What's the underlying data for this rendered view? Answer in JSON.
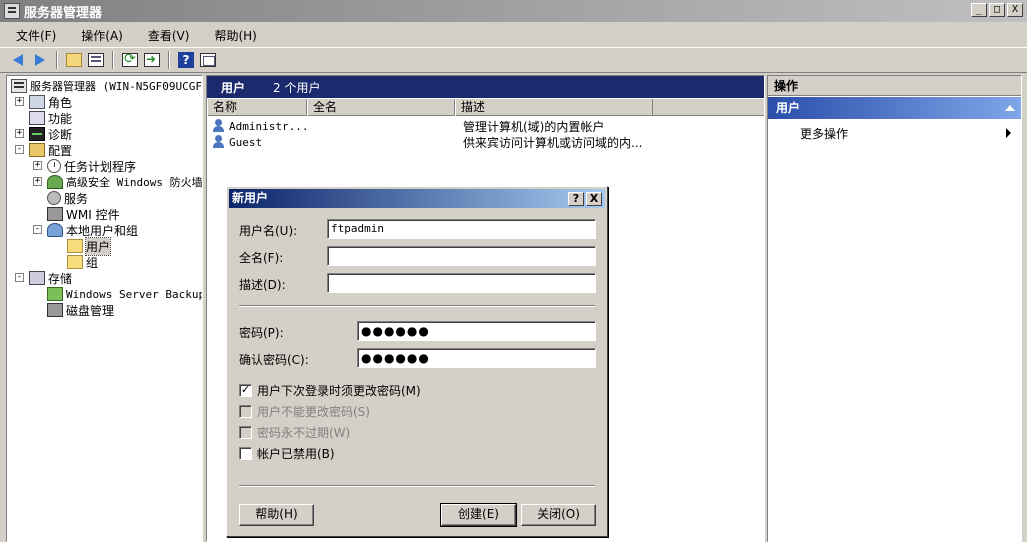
{
  "window": {
    "title": "服务器管理器",
    "controls": [
      "_",
      "□",
      "X"
    ]
  },
  "menu": [
    "文件(F)",
    "操作(A)",
    "查看(V)",
    "帮助(H)"
  ],
  "tree": {
    "root": "服务器管理器 (WIN-N5GF09UCGF",
    "items": [
      {
        "label": "角色",
        "icon": "roles-icon",
        "expander": "+"
      },
      {
        "label": "功能",
        "icon": "features-icon",
        "expander": ""
      },
      {
        "label": "诊断",
        "icon": "diagnostics-icon",
        "expander": "+"
      },
      {
        "label": "配置",
        "icon": "configuration-icon",
        "expander": "-"
      },
      {
        "label": "任务计划程序",
        "icon": "clock-icon",
        "expander": "+"
      },
      {
        "label": "高级安全 Windows 防火墙",
        "icon": "firewall-icon",
        "expander": "+"
      },
      {
        "label": "服务",
        "icon": "services-icon",
        "expander": ""
      },
      {
        "label": "WMI 控件",
        "icon": "wmi-icon",
        "expander": ""
      },
      {
        "label": "本地用户和组",
        "icon": "users-icon",
        "expander": "-"
      },
      {
        "label": "用户",
        "icon": "folder-icon",
        "expander": ""
      },
      {
        "label": "组",
        "icon": "folder-icon",
        "expander": ""
      },
      {
        "label": "存储",
        "icon": "storage-icon",
        "expander": "-"
      },
      {
        "label": "Windows Server Backup",
        "icon": "backup-icon",
        "expander": ""
      },
      {
        "label": "磁盘管理",
        "icon": "disk-icon",
        "expander": ""
      }
    ]
  },
  "center": {
    "title": "用户",
    "count": "2 个用户",
    "columns": [
      "名称",
      "全名",
      "描述"
    ],
    "rows": [
      {
        "name": "Administr...",
        "fullname": "",
        "desc": "管理计算机(域)的内置帐户"
      },
      {
        "name": "Guest",
        "fullname": "",
        "desc": "供来宾访问计算机或访问域的内..."
      }
    ]
  },
  "actions": {
    "header": "操作",
    "group": "用户",
    "items": [
      "更多操作"
    ]
  },
  "dialog": {
    "title": "新用户",
    "help_glyph": "?",
    "close_glyph": "X",
    "username_label": "用户名(U):",
    "username_value": "ftpadmin",
    "fullname_label": "全名(F):",
    "fullname_value": "",
    "desc_label": "描述(D):",
    "desc_value": "",
    "password_label": "密码(P):",
    "password_value": "●●●●●●",
    "confirm_label": "确认密码(C):",
    "confirm_value": "●●●●●●",
    "checkboxes": [
      {
        "label": "用户下次登录时须更改密码(M)",
        "checked": true,
        "enabled": true
      },
      {
        "label": "用户不能更改密码(S)",
        "checked": false,
        "enabled": false
      },
      {
        "label": "密码永不过期(W)",
        "checked": false,
        "enabled": false
      },
      {
        "label": "帐户已禁用(B)",
        "checked": false,
        "enabled": true
      }
    ],
    "help_button": "帮助(H)",
    "create_button": "创建(E)",
    "close_button": "关闭(O)"
  }
}
